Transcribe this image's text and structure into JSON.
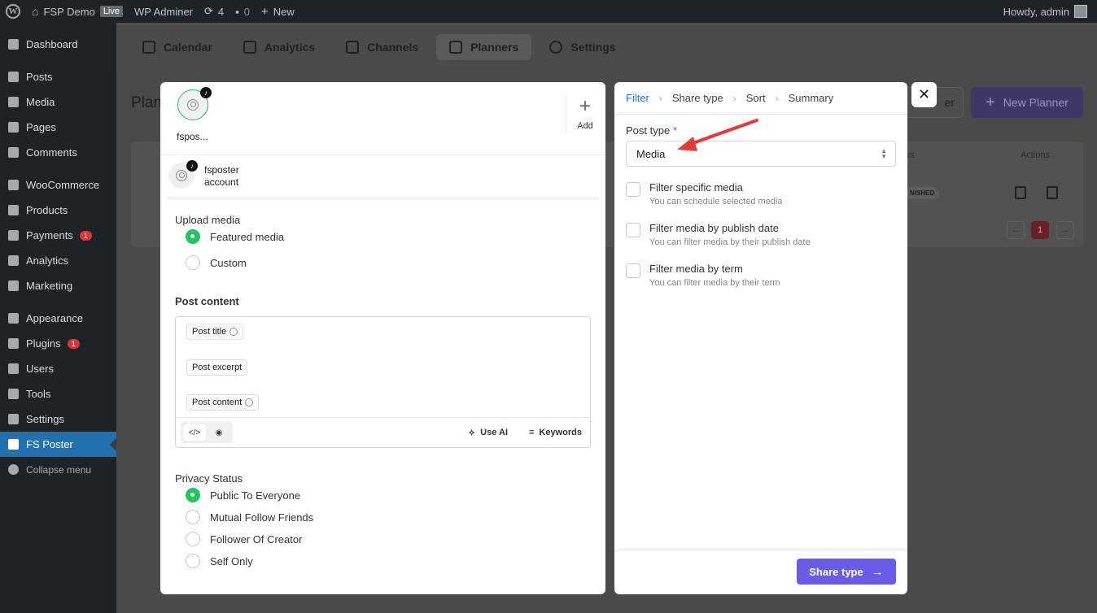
{
  "adminbar": {
    "site_name": "FSP Demo",
    "live_badge": "Live",
    "adminer": "WP Adminer",
    "updates_count": "4",
    "comments_count": "0",
    "new_label": "New",
    "howdy": "Howdy, admin"
  },
  "sidebar": {
    "items": [
      {
        "label": "Dashboard"
      },
      {
        "label": "Posts"
      },
      {
        "label": "Media"
      },
      {
        "label": "Pages"
      },
      {
        "label": "Comments"
      },
      {
        "label": "WooCommerce"
      },
      {
        "label": "Products"
      },
      {
        "label": "Payments",
        "badge": "1"
      },
      {
        "label": "Analytics"
      },
      {
        "label": "Marketing"
      },
      {
        "label": "Appearance"
      },
      {
        "label": "Plugins",
        "badge": "1"
      },
      {
        "label": "Users"
      },
      {
        "label": "Tools"
      },
      {
        "label": "Settings"
      },
      {
        "label": "FS Poster"
      }
    ],
    "collapse": "Collapse menu"
  },
  "topnav": {
    "tabs": [
      "Calendar",
      "Analytics",
      "Channels",
      "Planners",
      "Settings"
    ],
    "active": "Planners"
  },
  "background": {
    "title": "Plan",
    "filter_button": "er",
    "new_planner_button": "New Planner",
    "status_header": "us",
    "actions_header": "Actions",
    "status_badge": "NISHED",
    "page_current": "1"
  },
  "left_modal": {
    "channel": {
      "name": "fspos..."
    },
    "add_label": "Add",
    "account": {
      "name": "fsposter",
      "sub": "account"
    },
    "upload_media": {
      "label": "Upload media",
      "options": [
        "Featured media",
        "Custom"
      ],
      "selected": "Featured media"
    },
    "post_content": {
      "label": "Post content",
      "chips": [
        "Post title",
        "Post excerpt",
        "Post content"
      ],
      "use_ai": "Use AI",
      "keywords": "Keywords"
    },
    "privacy": {
      "label": "Privacy Status",
      "options": [
        "Public To Everyone",
        "Mutual Follow Friends",
        "Follower Of Creator",
        "Self Only"
      ],
      "selected": "Public To Everyone"
    }
  },
  "right_modal": {
    "steps": [
      "Filter",
      "Share type",
      "Sort",
      "Summary"
    ],
    "active_step": "Filter",
    "post_type_label": "Post type",
    "required_mark": "*",
    "post_type_value": "Media",
    "filters": [
      {
        "title": "Filter specific media",
        "hint": "You can schedule selected media"
      },
      {
        "title": "Filter media by publish date",
        "hint": "You can filter media by their publish date"
      },
      {
        "title": "Filter media by term",
        "hint": "You can filter media by their term"
      }
    ],
    "next_button": "Share type"
  },
  "colors": {
    "accent": "#6b5ce7",
    "active_radio": "#22c55e",
    "step_active": "#2a6fd6",
    "annotation_arrow": "#e53935",
    "wp_dark": "#1d2327",
    "wp_blue": "#2271b1"
  }
}
